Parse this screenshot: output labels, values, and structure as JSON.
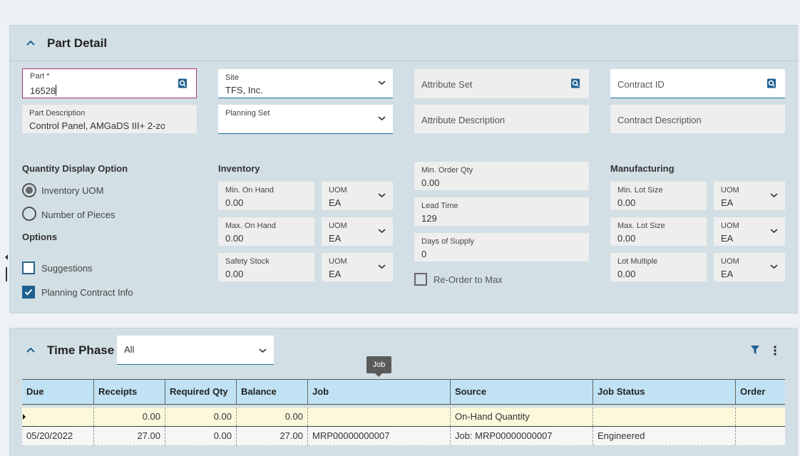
{
  "part_detail": {
    "title": "Part Detail",
    "part": {
      "label": "Part *",
      "value": "16528"
    },
    "site": {
      "label": "Site",
      "value": "TFS, Inc."
    },
    "attribute_set": {
      "placeholder": "Attribute Set"
    },
    "contract_id": {
      "placeholder": "Contract ID"
    },
    "part_description": {
      "label": "Part Description",
      "value": "Control Panel, AMGaDS III+ 2-zoı"
    },
    "planning_set": {
      "label": "Planning Set",
      "value": ""
    },
    "attribute_description": {
      "placeholder": "Attribute Description"
    },
    "contract_description": {
      "placeholder": "Contract Description"
    },
    "quantity_display": {
      "label": "Quantity Display Option",
      "options": [
        "Inventory UOM",
        "Number of Pieces"
      ],
      "selected": "Inventory UOM"
    },
    "options": {
      "label": "Options",
      "suggestions": {
        "label": "Suggestions",
        "checked": false
      },
      "planning_contract_info": {
        "label": "Planning Contract Info",
        "checked": true
      }
    },
    "inventory": {
      "label": "Inventory",
      "min_on_hand": {
        "label": "Min. On Hand",
        "value": "0.00",
        "uom_label": "UOM",
        "uom": "EA"
      },
      "max_on_hand": {
        "label": "Max. On Hand",
        "value": "0.00",
        "uom_label": "UOM",
        "uom": "EA"
      },
      "safety_stock": {
        "label": "Safety Stock",
        "value": "0.00",
        "uom_label": "UOM",
        "uom": "EA"
      }
    },
    "ordering": {
      "min_order_qty": {
        "label": "Min. Order Qty",
        "value": "0.00"
      },
      "lead_time": {
        "label": "Lead Time",
        "value": "129"
      },
      "days_of_supply": {
        "label": "Days of Supply",
        "value": "0"
      },
      "reorder_to_max": {
        "label": "Re-Order to Max",
        "checked": false
      }
    },
    "manufacturing": {
      "label": "Manufacturing",
      "min_lot_size": {
        "label": "Min. Lot Size",
        "value": "0.00",
        "uom_label": "UOM",
        "uom": "EA"
      },
      "max_lot_size": {
        "label": "Max. Lot Size",
        "value": "0.00",
        "uom_label": "UOM",
        "uom": "EA"
      },
      "lot_multiple": {
        "label": "Lot Multiple",
        "value": "0.00",
        "uom_label": "UOM",
        "uom": "EA"
      }
    }
  },
  "time_phase": {
    "title": "Time Phase",
    "filter_value": "All",
    "tooltip": "Job",
    "columns": [
      "Due",
      "Receipts",
      "Required Qty",
      "Balance",
      "Job",
      "Source",
      "Job Status",
      "Order"
    ],
    "rows": [
      [
        "",
        "0.00",
        "0.00",
        "0.00",
        "",
        "On-Hand Quantity",
        "",
        ""
      ],
      [
        "05/20/2022",
        "27.00",
        "0.00",
        "27.00",
        "MRP00000000007",
        "Job: MRP00000000007",
        "Engineered",
        ""
      ]
    ]
  },
  "colors": {
    "accent": "#1e5f8f",
    "panel": "#d2dfe4",
    "header_row": "#c0e2f4",
    "selected_row": "#fbf8dc"
  }
}
